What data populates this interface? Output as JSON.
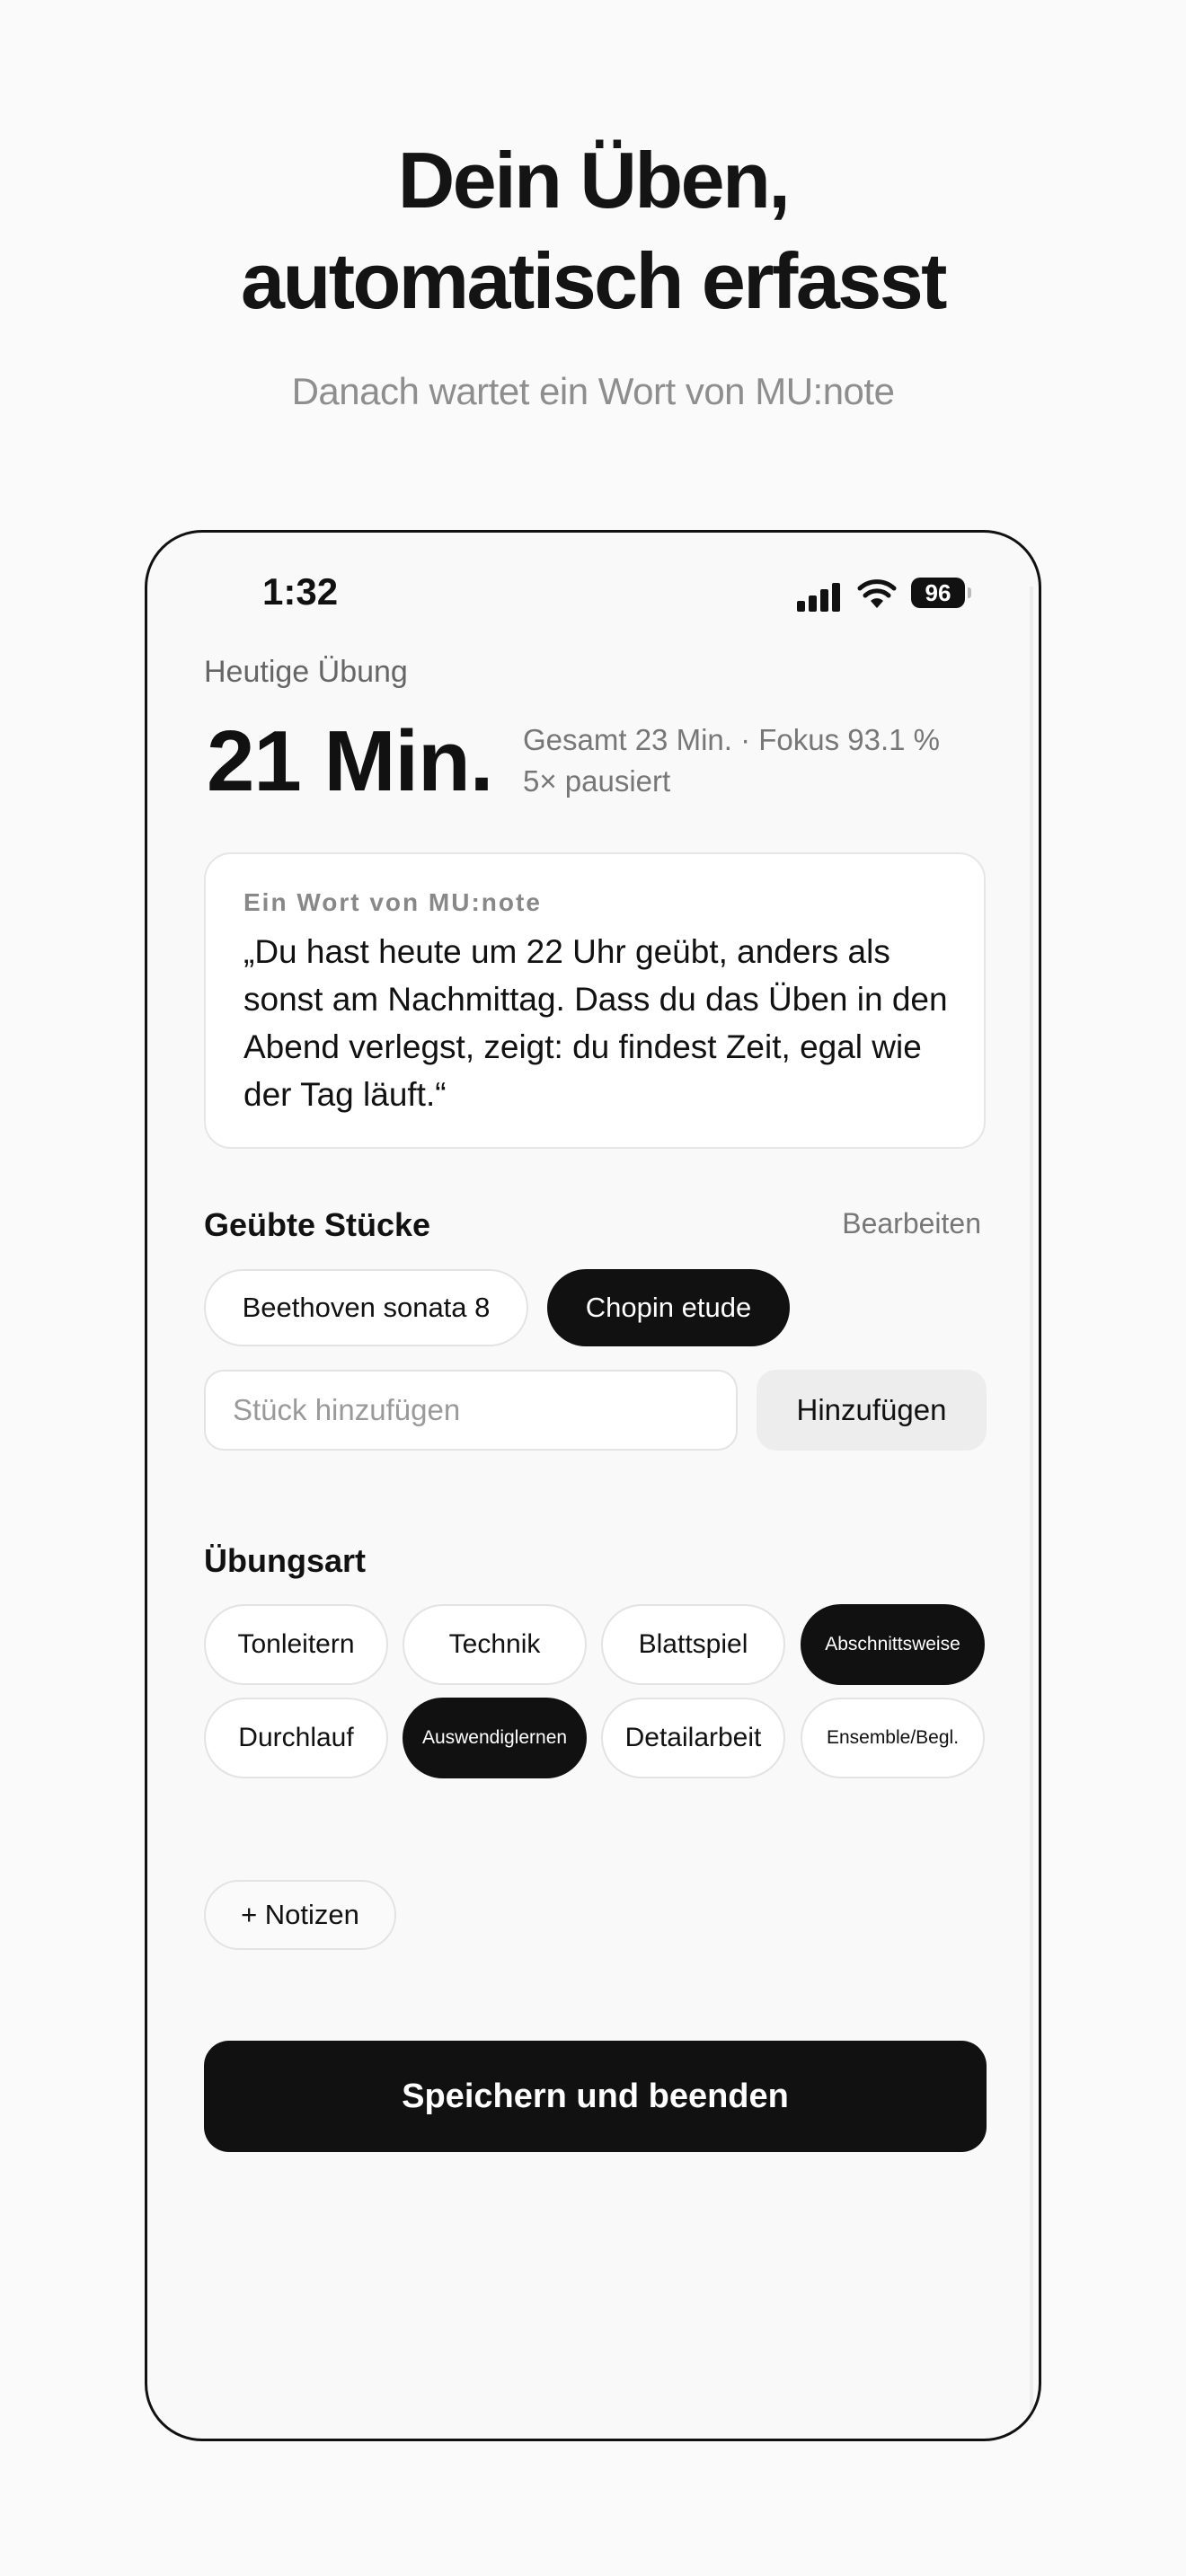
{
  "headline": {
    "line1": "Dein Üben,",
    "line2": "automatisch erfasst",
    "subline": "Danach wartet ein Wort von MU:note"
  },
  "status_bar": {
    "time": "1:32",
    "battery": "96"
  },
  "summary": {
    "label": "Heutige Übung",
    "minutes": "21 Min.",
    "stats_line1": "Gesamt 23 Min. · Fokus 93.1 %",
    "stats_line2": "5× pausiert"
  },
  "quote": {
    "label": "Ein Wort von MU:note",
    "text": "„Du hast heute um 22 Uhr geübt, anders als sonst am Nachmittag. Dass du das Üben in den Abend verlegst, zeigt: du findest Zeit, egal wie der Tag läuft.“"
  },
  "pieces": {
    "title": "Geübte Stücke",
    "edit_label": "Bearbeiten",
    "items": [
      {
        "label": "Beethoven sonata 8",
        "selected": false
      },
      {
        "label": "Chopin etude",
        "selected": true
      }
    ],
    "input_placeholder": "Stück hinzufügen",
    "add_label": "Hinzufügen"
  },
  "practice_type": {
    "title": "Übungsart",
    "options": [
      {
        "label": "Tonleitern",
        "selected": false
      },
      {
        "label": "Technik",
        "selected": false
      },
      {
        "label": "Blattspiel",
        "selected": false
      },
      {
        "label": "Abschnittsweise",
        "selected": true
      },
      {
        "label": "Durchlauf",
        "selected": false
      },
      {
        "label": "Auswendiglernen",
        "selected": true
      },
      {
        "label": "Detailarbeit",
        "selected": false
      },
      {
        "label": "Ensemble/Begl.",
        "selected": false
      }
    ]
  },
  "notes_label": "+ Notizen",
  "save_label": "Speichern und beenden",
  "colors": {
    "background": "#fafafa",
    "accent": "#111111",
    "muted_text": "#8e8e8e"
  }
}
